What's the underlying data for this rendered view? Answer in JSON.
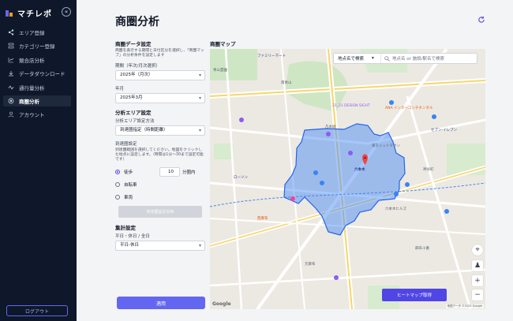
{
  "app": {
    "name": "マチレポ"
  },
  "sidebar": {
    "items": [
      {
        "label": "エリア登録",
        "icon": "share-icon",
        "active": false
      },
      {
        "label": "カテゴリー登録",
        "icon": "layers-icon",
        "active": false
      },
      {
        "label": "競合店分析",
        "icon": "graph-icon",
        "active": false
      },
      {
        "label": "データダウンロード",
        "icon": "download-icon",
        "active": false
      },
      {
        "label": "通行量分析",
        "icon": "pulse-icon",
        "active": false
      },
      {
        "label": "商圏分析",
        "icon": "target-icon",
        "active": true
      },
      {
        "label": "アカウント",
        "icon": "user-icon",
        "active": false
      }
    ],
    "logout_label": "ログアウト"
  },
  "page": {
    "title": "商圏分析"
  },
  "panel": {
    "data_settings": {
      "title": "商圏データ設定",
      "description": "商圏を表示する期間と日付区分を選択し、「商圏マップ」の分析条件を設定します",
      "period_label": "期間（年次/月次選択）",
      "period_value": "2025年（月次）",
      "month_label": "年月",
      "month_value": "2025年3月"
    },
    "area_settings": {
      "title": "分析エリア設定",
      "method_label": "分析エリア設定方法",
      "method_value": "到達圏指定（時間距離）",
      "reach_label": "到達圏設定",
      "reach_description": "到達圏範囲を選択してください。地図をクリックした地点に設定します。（時間は1分〜30まで設定可能です）",
      "options": [
        {
          "label": "徒歩",
          "selected": true
        },
        {
          "label": "自転車",
          "selected": false
        },
        {
          "label": "車両",
          "selected": false
        }
      ],
      "minutes_value": "10",
      "minutes_unit": "分圏内",
      "disabled_button": "到達圏設定反映"
    },
    "aggregate_settings": {
      "title": "集計設定",
      "day_label": "平日・休日 / 全日",
      "day_value": "平日-休日"
    },
    "apply_label": "適用"
  },
  "map": {
    "title": "商圏マップ",
    "search_mode": "地点名で検索",
    "search_placeholder": "地点名 or 施設/駅名で検索",
    "heatmap_button": "ヒートマップ取得",
    "attribution": "地図データ ©2025 Google",
    "logo": "Google",
    "labels": [
      "乃木坂",
      "六本木",
      "21_21 DESIGN SIGHT",
      "ANA インターコンチネンタル",
      "東京ミッドタウン",
      "六本木ヒルズ",
      "青山霊園",
      "南青山",
      "西麻布",
      "麻布十番",
      "元麻布",
      "神谷町",
      "ファミリーマート",
      "セブン-イレブン",
      "ローソン"
    ]
  },
  "colors": {
    "accent": "#6366f1",
    "sidebar_bg": "#0f172a",
    "reach_fill": "#3b82f6"
  }
}
